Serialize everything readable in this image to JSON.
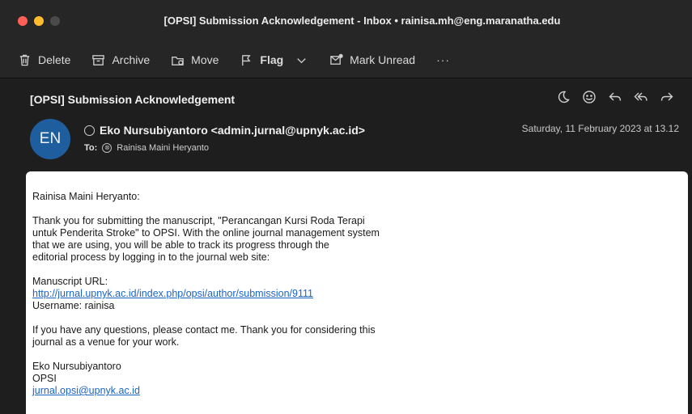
{
  "window": {
    "title": "[OPSI] Submission Acknowledgement - Inbox • rainisa.mh@eng.maranatha.edu"
  },
  "toolbar": {
    "delete": "Delete",
    "archive": "Archive",
    "move": "Move",
    "flag": "Flag",
    "mark_unread": "Mark Unread",
    "more": "···"
  },
  "message": {
    "subject": "[OPSI] Submission Acknowledgement",
    "avatar_initials": "EN",
    "sender": "Eko Nursubiyantoro <admin.jurnal@upnyk.ac.id>",
    "to_label": "To:",
    "to_name": "Rainisa Maini Heryanto",
    "date": "Saturday, 11 February 2023 at 13.12",
    "body": {
      "greeting": "Rainisa Maini Heryanto:",
      "para1_line1": "Thank you for submitting the manuscript, \"Perancangan Kursi Roda Terapi",
      "para1_line2": "untuk Penderita Stroke\" to OPSI. With the online journal management system",
      "para1_line3": "that we are using, you will be able to track its progress through the",
      "para1_line4": "editorial process by logging in to the journal web site:",
      "manuscript_label": "Manuscript URL:",
      "manuscript_url": "http://jurnal.upnyk.ac.id/index.php/opsi/author/submission/9111",
      "username": "Username: rainisa",
      "para2_line1": "If you have any questions, please contact me. Thank you for considering this",
      "para2_line2": "journal as a venue for your work.",
      "sig_name": "Eko Nursubiyantoro",
      "sig_org": "OPSI",
      "sig_email": "jurnal.opsi@upnyk.ac.id"
    }
  },
  "icons": [
    "trash-icon",
    "archive-icon",
    "move-icon",
    "flag-icon",
    "chevron-down-icon",
    "mark-unread-icon",
    "snooze-icon",
    "emoji-icon",
    "reply-icon",
    "reply-all-icon",
    "forward-icon"
  ],
  "colors": {
    "accent_avatar": "#1f5e9e",
    "link": "#1a64c8"
  }
}
